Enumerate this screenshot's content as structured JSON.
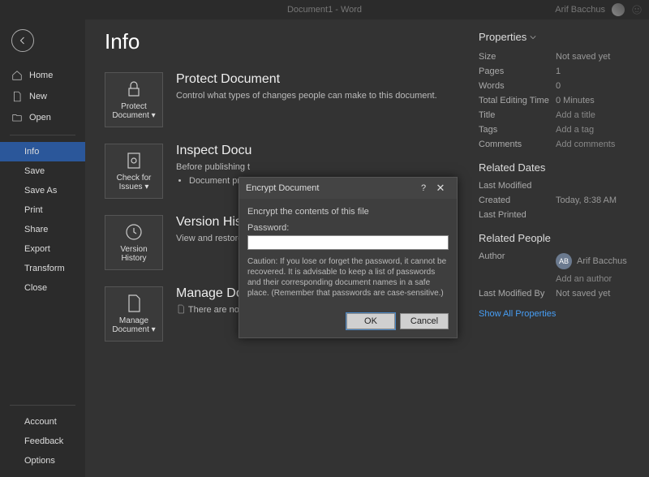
{
  "titlebar": {
    "document": "Document1 - Word",
    "username": "Arif Bacchus"
  },
  "nav": {
    "top": [
      {
        "label": "Home",
        "icon": "home-icon"
      },
      {
        "label": "New",
        "icon": "new-icon"
      },
      {
        "label": "Open",
        "icon": "open-icon"
      }
    ],
    "mid": [
      {
        "label": "Info",
        "selected": true
      },
      {
        "label": "Save"
      },
      {
        "label": "Save As"
      },
      {
        "label": "Print"
      },
      {
        "label": "Share"
      },
      {
        "label": "Export"
      },
      {
        "label": "Transform"
      },
      {
        "label": "Close"
      }
    ],
    "bottom": [
      {
        "label": "Account"
      },
      {
        "label": "Feedback"
      },
      {
        "label": "Options"
      }
    ]
  },
  "page": {
    "title": "Info"
  },
  "sections": {
    "protect": {
      "button": "Protect Document ▾",
      "title": "Protect Document",
      "desc": "Control what types of changes people can make to this document."
    },
    "inspect": {
      "button": "Check for Issues ▾",
      "title": "Inspect Docu",
      "desc": "Before publishing t",
      "bullet": "Document pro"
    },
    "version": {
      "button": "Version History",
      "title": "Version Histo",
      "desc": "View and restore pr"
    },
    "manage": {
      "button": "Manage Document ▾",
      "title": "Manage Document",
      "desc": "There are no unsaved changes."
    }
  },
  "properties": {
    "header": "Properties",
    "rows": [
      {
        "label": "Size",
        "value": "Not saved yet"
      },
      {
        "label": "Pages",
        "value": "1"
      },
      {
        "label": "Words",
        "value": "0"
      },
      {
        "label": "Total Editing Time",
        "value": "0 Minutes"
      },
      {
        "label": "Title",
        "value": "Add a title",
        "add": true
      },
      {
        "label": "Tags",
        "value": "Add a tag",
        "add": true
      },
      {
        "label": "Comments",
        "value": "Add comments",
        "add": true
      }
    ],
    "dates_header": "Related Dates",
    "dates": [
      {
        "label": "Last Modified",
        "value": ""
      },
      {
        "label": "Created",
        "value": "Today, 8:38 AM"
      },
      {
        "label": "Last Printed",
        "value": ""
      }
    ],
    "people_header": "Related People",
    "author_label": "Author",
    "author_initials": "AB",
    "author_name": "Arif Bacchus",
    "add_author": "Add an author",
    "last_modified_by_label": "Last Modified By",
    "last_modified_by": "Not saved yet",
    "show_all": "Show All Properties"
  },
  "dialog": {
    "title": "Encrypt Document",
    "subtitle": "Encrypt the contents of this file",
    "field_label": "Password:",
    "field_value": "",
    "caution": "Caution: If you lose or forget the password, it cannot be recovered. It is advisable to keep a list of passwords and their corresponding document names in a safe place. (Remember that passwords are case-sensitive.)",
    "ok": "OK",
    "cancel": "Cancel"
  }
}
